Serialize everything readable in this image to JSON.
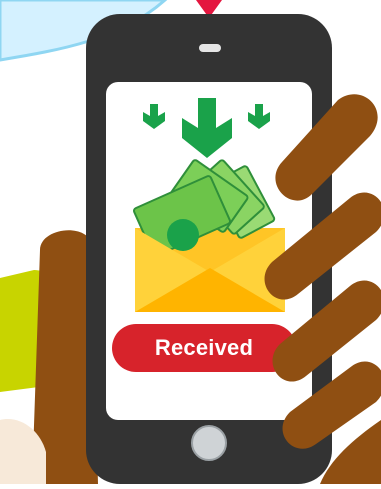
{
  "status": {
    "label": "Received",
    "color": "#d7232b"
  },
  "icons": {
    "incoming": "down-arrows-icon",
    "envelope": "money-envelope-icon",
    "hand": "hand-icon",
    "home_button": "home-button-icon"
  },
  "colors": {
    "phone_body": "#333333",
    "screen": "#ffffff",
    "arrow": "#1aa24a",
    "envelope": "#ffc526",
    "cash": "#7ccf58",
    "skin": "#8f4f12",
    "sky_blob": "#cfefff",
    "pin": "#e4163f",
    "yellow_green_blob": "#c8d400"
  }
}
